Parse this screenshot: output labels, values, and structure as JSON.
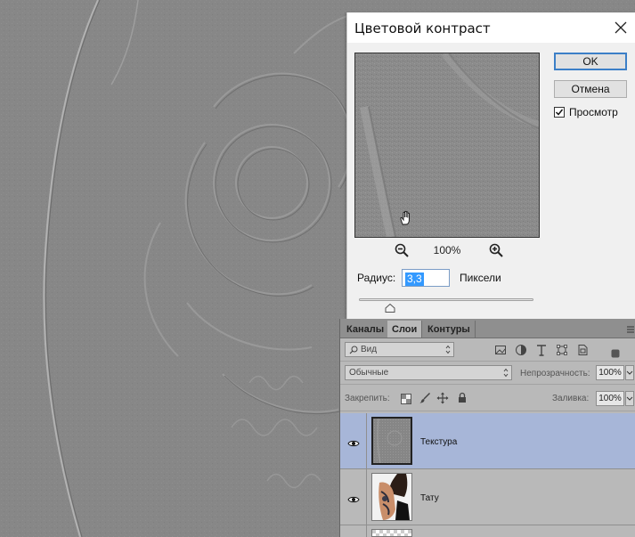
{
  "dialog": {
    "title": "Цветовой контраст",
    "ok_label": "OK",
    "cancel_label": "Отмена",
    "preview_label": "Просмотр",
    "preview_checked": true,
    "zoom_level": "100%",
    "zoom_out_icon": "zoom-out-icon",
    "zoom_in_icon": "zoom-in-icon",
    "radius_label": "Радиус:",
    "radius_value": "3,3",
    "radius_unit": "Пиксели"
  },
  "layers_panel": {
    "tabs": [
      {
        "label": "Каналы",
        "active": false
      },
      {
        "label": "Слои",
        "active": true
      },
      {
        "label": "Контуры",
        "active": false
      }
    ],
    "filter": {
      "kind_label": "Вид"
    },
    "blend_mode": "Обычные",
    "opacity_label": "Непрозрачность:",
    "opacity_value": "100%",
    "lock_label": "Закрепить:",
    "fill_label": "Заливка:",
    "fill_value": "100%",
    "layers": [
      {
        "name": "Текстура",
        "visible": true,
        "selected": true
      },
      {
        "name": "Тату",
        "visible": true,
        "selected": false
      }
    ]
  },
  "colors": {
    "accent": "#3399ff",
    "selected_layer": "#a7b6d8",
    "canvas": "#878787"
  }
}
